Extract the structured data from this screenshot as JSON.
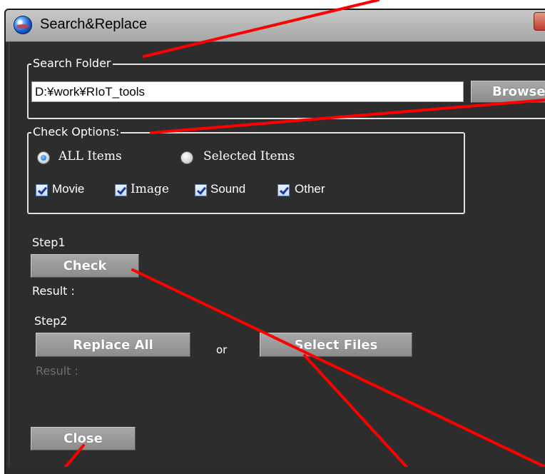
{
  "window": {
    "title": "Search&Replace"
  },
  "search_folder": {
    "legend": "Search Folder",
    "path_value": "D:¥work¥RIoT_tools",
    "browse_label": "Browse"
  },
  "check_options": {
    "legend": "Check Options:",
    "radios": [
      {
        "label": "ALL Items",
        "selected": true
      },
      {
        "label": "Selected Items",
        "selected": false
      }
    ],
    "checkboxes": [
      {
        "label": "Movie",
        "checked": true
      },
      {
        "label": "Image",
        "checked": true
      },
      {
        "label": "Sound",
        "checked": true
      },
      {
        "label": "Other",
        "checked": true
      }
    ]
  },
  "step1": {
    "label": "Step1",
    "check_label": "Check",
    "result_label": "Result :"
  },
  "step2": {
    "label": "Step2",
    "replace_all_label": "Replace All",
    "or_label": "or",
    "select_files_label": "Select Files",
    "result_label": "Result :"
  },
  "footer": {
    "close_label": "Close"
  },
  "colors": {
    "annotation": "#ff0000",
    "window_bg": "#2d2d2d",
    "button": "#9a9a9a"
  }
}
